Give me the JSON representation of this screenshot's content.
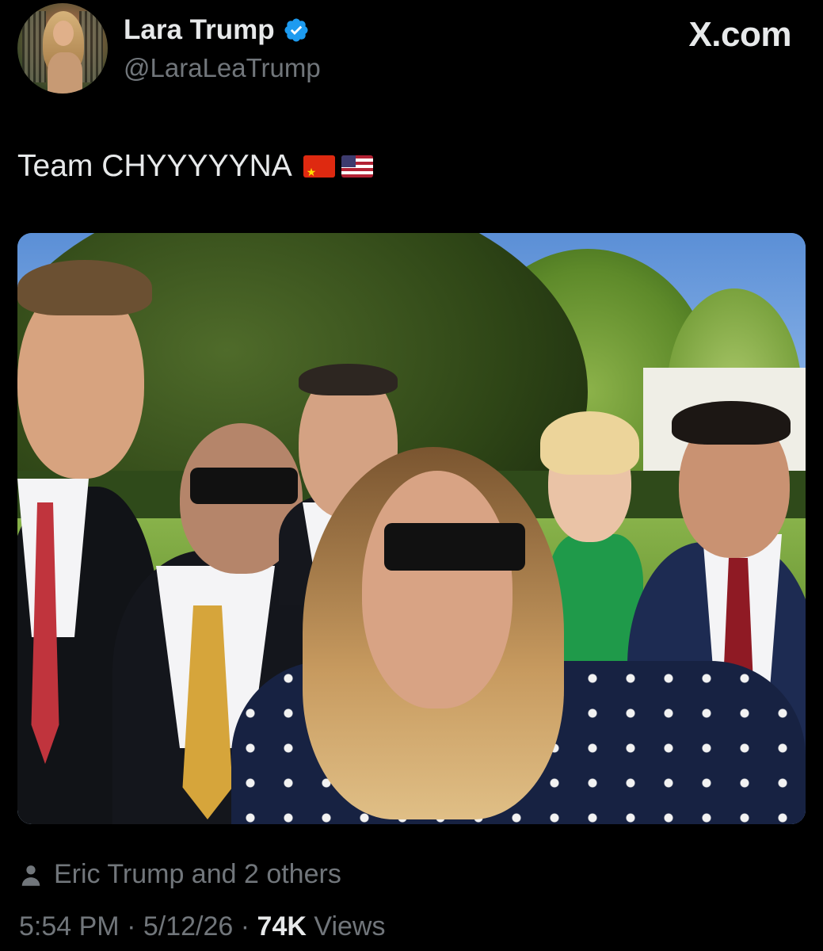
{
  "author": {
    "display_name": "Lara Trump",
    "handle": "@LaraLeaTrump",
    "verified": true,
    "avatar_icon": "profile-photo"
  },
  "brand": {
    "label": "X.com"
  },
  "tweet": {
    "text": "Team CHYYYYYNA",
    "emoji": [
      "china-flag",
      "us-flag"
    ]
  },
  "media": {
    "type": "photo"
  },
  "tagged": {
    "icon": "person-icon",
    "label": "Eric Trump and 2 others"
  },
  "footer": {
    "time": "5:54 PM",
    "date": "5/12/26",
    "views_count": "74K",
    "views_label": "Views",
    "separator": "·"
  },
  "colors": {
    "background": "#000000",
    "primary_text": "#e7e9ea",
    "secondary_text": "#71767b",
    "verified_badge": "#1d9bf0"
  }
}
